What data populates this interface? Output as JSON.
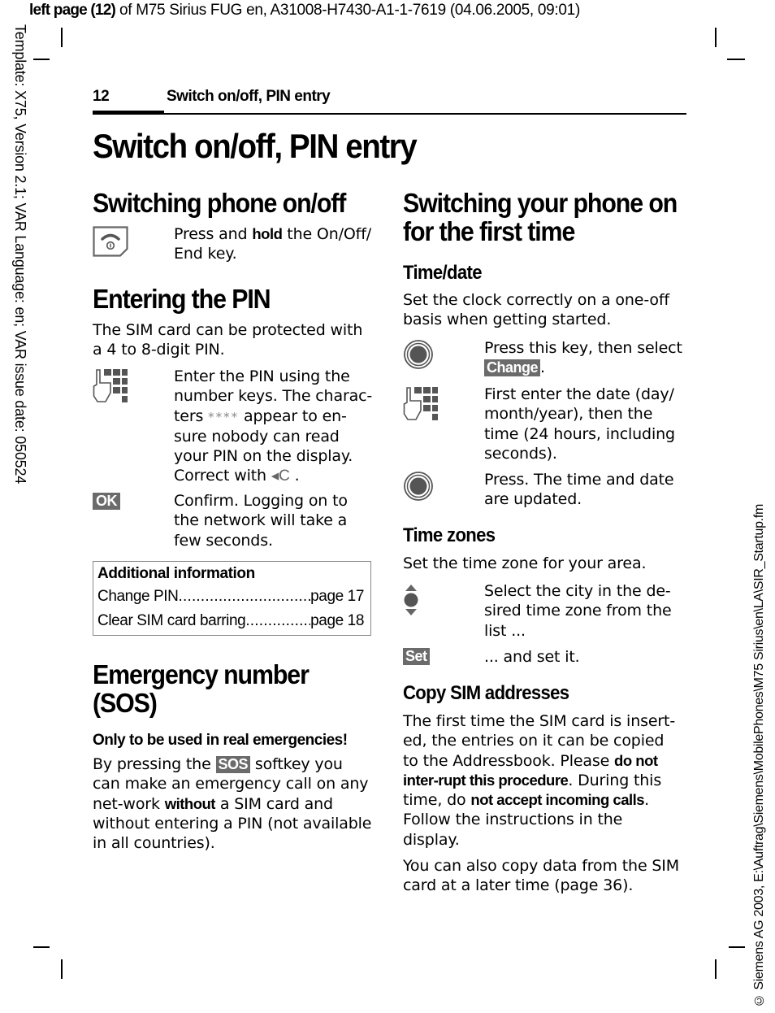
{
  "meta": {
    "top_line_bold": "left page (12)",
    "top_line_rest": " of M75 Sirius FUG en, A31008-H7430-A1-1-7619 (04.06.2005, 09:01)",
    "left_margin": "Template: X75, Version 2.1; VAR Language: en; VAR issue date: 050524",
    "right_margin": "© Siemens AG 2003, E:\\Auftrag\\Siemens\\MobilePhones\\M75 Sirius\\en\\LA\\SIR_Startup.fm"
  },
  "header": {
    "page_number": "12",
    "running_title": "Switch on/off, PIN entry"
  },
  "title": "Switch on/off, PIN entry",
  "left": {
    "switching": {
      "heading": "Switching phone on/off",
      "step": {
        "icon": "on-off-end-key-icon",
        "pre": "Press and ",
        "bold": "hold",
        "post": " the On/Off/ End key."
      }
    },
    "pin": {
      "heading": "Entering the PIN",
      "intro": "The SIM card can be protected with a 4 to 8-digit PIN.",
      "step1": {
        "icon": "keypad-icon",
        "pre": "Enter the PIN using the number keys. The charac-ters ",
        "mask": "****",
        "mid": " appear to en-sure nobody can read your PIN on the display. Correct with ",
        "clear_key": "◂C",
        "post": " ."
      },
      "step2": {
        "softkey": "OK",
        "text": "Confirm. Logging on to the network will take a few seconds."
      }
    },
    "info_box": {
      "title": "Additional information",
      "rows": [
        {
          "label": "Change PIN",
          "page": "page 17"
        },
        {
          "label": "Clear SIM card barring ",
          "page": "page 18"
        }
      ]
    },
    "sos": {
      "heading_line1": "Emergency number",
      "heading_line2": "(SOS)",
      "warning": "Only to be used in real emergencies!",
      "p_pre": "By pressing the ",
      "softkey": "SOS",
      "p_mid": " softkey you can make an emergency call on any net-work ",
      "p_bold": "without",
      "p_post": " a SIM card and without entering a PIN (not available in all countries)."
    }
  },
  "right": {
    "heading_line1": "Switching your phone on",
    "heading_line2": "for the first time",
    "timedate": {
      "heading": "Time/date",
      "intro": "Set the clock correctly on a one-off basis when getting started.",
      "step1": {
        "icon": "control-key-icon",
        "pre": "Press this key, then select ",
        "softkey": "Change",
        "post": "."
      },
      "step2": {
        "icon": "keypad-icon",
        "text": "First enter the date (day/ month/year), then the time (24 hours, including seconds)."
      },
      "step3": {
        "icon": "control-key-icon",
        "text": "Press. The time and date are updated."
      }
    },
    "timezones": {
      "heading": "Time zones",
      "intro": "Set the time zone for your area.",
      "step1": {
        "icon": "navigation-key-icon",
        "text": "Select the city in the de-sired time zone from the list ..."
      },
      "step2": {
        "softkey": "Set",
        "text": "... and set it."
      }
    },
    "copysim": {
      "heading": "Copy SIM addresses",
      "p1_a": "The first time the SIM card is insert-ed, the entries on it can be copied to the Addressbook. Please ",
      "p1_b": "do not inter-rupt this procedure",
      "p1_c": ". During this time, do ",
      "p1_d": "not accept incoming calls",
      "p1_e": ". Follow the instructions in the display.",
      "p2": "You can also copy data from the SIM card at a later time (page 36)."
    }
  }
}
